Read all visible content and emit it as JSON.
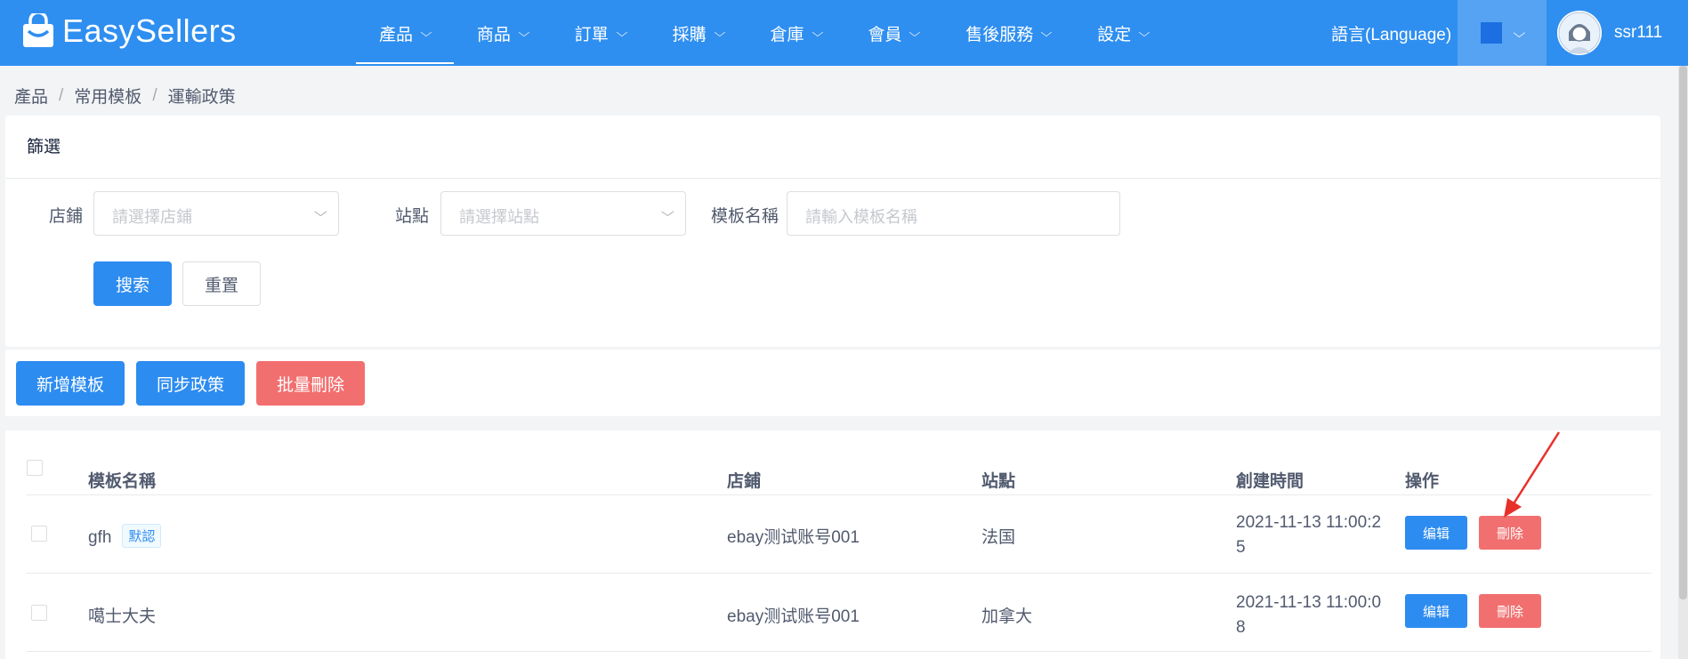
{
  "app": {
    "logo_text": "EasySellers",
    "brand_color": "#2f8ff0"
  },
  "nav": {
    "items": [
      {
        "label": "產品",
        "active": true
      },
      {
        "label": "商品"
      },
      {
        "label": "訂單"
      },
      {
        "label": "採購"
      },
      {
        "label": "倉庫"
      },
      {
        "label": "會員"
      },
      {
        "label": "售後服務"
      },
      {
        "label": "設定"
      }
    ],
    "chevron": "chevron-down-icon",
    "language": "語言(Language)",
    "username": "ssr111"
  },
  "breadcrumb": [
    "產品",
    "常用模板",
    "運輸政策"
  ],
  "filter": {
    "title": "篩選",
    "store_label": "店鋪",
    "store_placeholder": "請選擇店鋪",
    "site_label": "站點",
    "site_placeholder": "請選擇站點",
    "template_label": "模板名稱",
    "template_placeholder": "請輸入模板名稱",
    "search_label": "搜索",
    "reset_label": "重置"
  },
  "actions": {
    "add_label": "新增模板",
    "sync_label": "同步政策",
    "batch_delete_label": "批量刪除"
  },
  "table": {
    "headers": {
      "name": "模板名稱",
      "store": "店鋪",
      "site": "站點",
      "created": "創建時間",
      "ops": "操作"
    },
    "rows": [
      {
        "name": "gfh",
        "tag": "默認",
        "store": "ebay测试账号001",
        "site": "法国",
        "created": "2021-11-13 11:00:25",
        "edit": "编辑",
        "delete": "刪除"
      },
      {
        "name": "噶士大夫",
        "tag": "",
        "store": "ebay测试账号001",
        "site": "加拿大",
        "created": "2021-11-13 11:00:08",
        "edit": "编辑",
        "delete": "刪除"
      }
    ]
  }
}
